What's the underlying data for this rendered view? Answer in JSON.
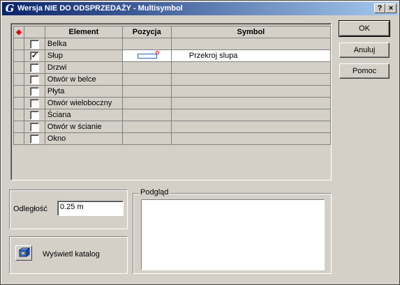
{
  "window": {
    "title": "Wersja NIE DO ODSPRZEDAŻY - Multisymbol",
    "logo_glyph": "G",
    "help_glyph": "?",
    "close_glyph": "×"
  },
  "buttons": {
    "ok": "OK",
    "cancel": "Anuluj",
    "help": "Pomoc"
  },
  "grid": {
    "headers": [
      "Element",
      "Pozycja",
      "Symbol"
    ],
    "header_marker": "◆",
    "rows": [
      {
        "element": "Belka",
        "checked": false,
        "checkmark": "",
        "position": "",
        "symbol": ""
      },
      {
        "element": "Słup",
        "checked": true,
        "checkmark": "✓",
        "position": "position-icon",
        "symbol": "Przekroj slupa"
      },
      {
        "element": "Drzwi",
        "checked": false,
        "checkmark": "",
        "position": "",
        "symbol": ""
      },
      {
        "element": "Otwór w belce",
        "checked": false,
        "checkmark": "",
        "position": "",
        "symbol": ""
      },
      {
        "element": "Płyta",
        "checked": false,
        "checkmark": "",
        "position": "",
        "symbol": ""
      },
      {
        "element": "Otwór wieloboczny",
        "checked": false,
        "checkmark": "",
        "position": "",
        "symbol": ""
      },
      {
        "element": "Ściana",
        "checked": false,
        "checkmark": "",
        "position": "",
        "symbol": ""
      },
      {
        "element": "Otwór w ścianie",
        "checked": false,
        "checkmark": "",
        "position": "",
        "symbol": ""
      },
      {
        "element": "Okno",
        "checked": false,
        "checkmark": "",
        "position": "",
        "symbol": ""
      }
    ]
  },
  "distance": {
    "label": "Odległość",
    "value": "0.25 m"
  },
  "catalog": {
    "label": "Wyświetl katalog",
    "icon": "catalog-icon"
  },
  "preview": {
    "legend": "Podgląd"
  },
  "colors": {
    "title_start": "#0a246a",
    "title_end": "#a6caf0",
    "face": "#d4d0c8",
    "marker": "#e00000"
  }
}
